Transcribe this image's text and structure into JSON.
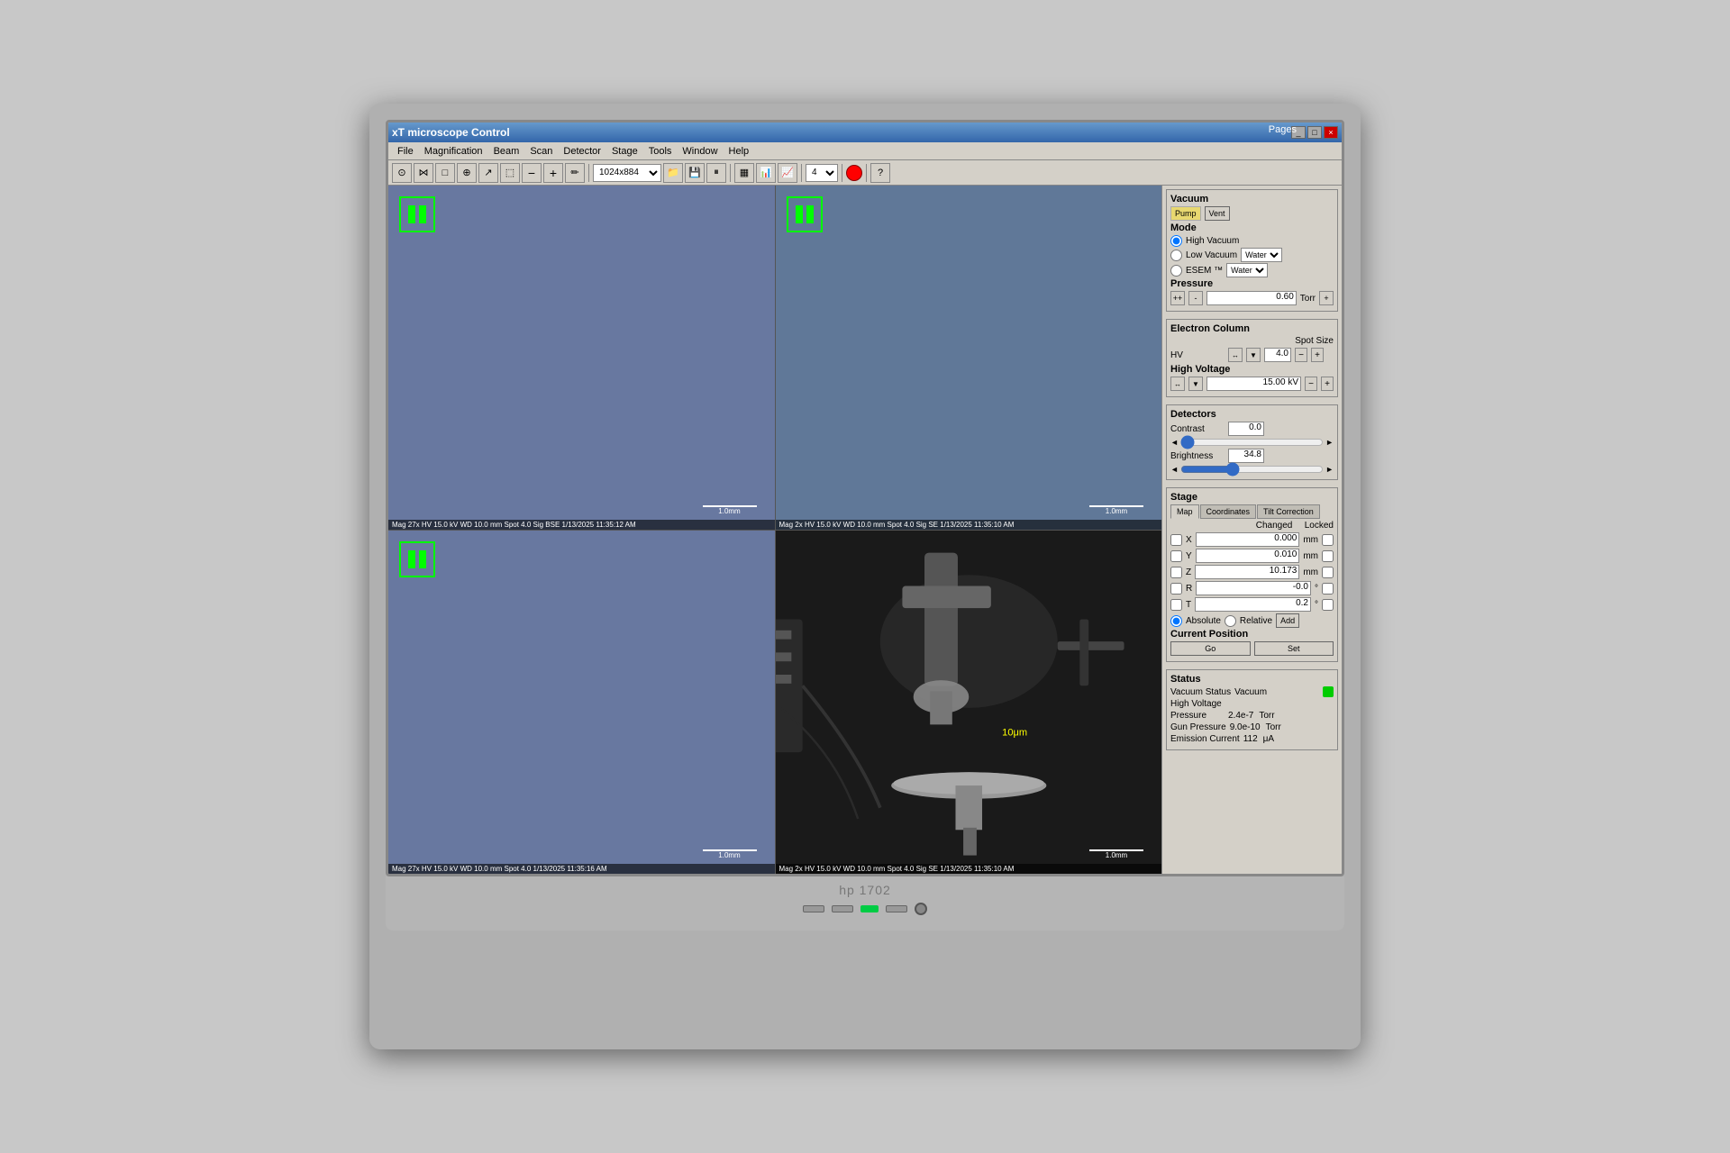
{
  "app": {
    "title": "xT microscope Control",
    "titlebar_controls": [
      "_",
      "□",
      "×"
    ]
  },
  "menu": {
    "items": [
      "File",
      "Magnification",
      "Beam",
      "Scan",
      "Detector",
      "Stage",
      "Tools",
      "Window",
      "Help"
    ]
  },
  "toolbar": {
    "resolution": "1024x884",
    "dropdown_num": "4"
  },
  "pages_label": "Pages",
  "panels": [
    {
      "id": "top-left",
      "info": "Mag 27x  HV 15.0 kV  WD 10.0 mm  Spot 4.0  Sig BSE  1/13/2025 11:35:12 AM",
      "scale": "1.0mm",
      "type": "blank"
    },
    {
      "id": "top-right",
      "info": "Mag 2x  HV 15.0 kV  WD 10.0 mm  Spot 4.0  Sig SE  1/13/2025 11:35:10 AM",
      "scale": "1.0mm",
      "type": "blank"
    },
    {
      "id": "bottom-left",
      "info": "Mag 27x  HV 15.0 kV  WD 10.0 mm  Spot 4.0  1/13/2025 11:35:16 AM",
      "scale": "1.0mm",
      "type": "blank"
    },
    {
      "id": "bottom-right",
      "info": "Mag 2x  HV 15.0 kV  WD 10.0 mm  Spot 4.0  Sig SE  1/13/2025 11:35:10 AM",
      "scale": "1.0mm",
      "type": "em"
    }
  ],
  "right_panel": {
    "vacuum": {
      "title": "Vacuum",
      "pump_label": "Pump",
      "vent_label": "Vent",
      "mode_title": "Mode",
      "high_vacuum": "High Vacuum",
      "low_vacuum": "Low Vacuum",
      "esem": "ESEM ™",
      "low_vacuum_medium": "Water",
      "esem_medium": "Water",
      "pressure_title": "Pressure",
      "pressure_value": "0.60",
      "pressure_unit": "Torr"
    },
    "electron_column": {
      "title": "Electron Column",
      "spot_size_label": "Spot Size",
      "hv_label": "HV",
      "spot_size_value": "4.0",
      "high_voltage_title": "High Voltage",
      "high_voltage_value": "15.00 kV"
    },
    "detectors": {
      "title": "Detectors",
      "contrast_label": "Contrast",
      "contrast_value": "0.0",
      "brightness_label": "Brightness",
      "brightness_value": "34.8"
    },
    "stage": {
      "title": "Stage",
      "tabs": [
        "Map",
        "Coordinates",
        "Tilt Correction"
      ],
      "changed_label": "Changed",
      "locked_label": "Locked",
      "x_label": "X",
      "x_value": "0.000",
      "x_unit": "mm",
      "y_label": "Y",
      "y_value": "0.010",
      "y_unit": "mm",
      "z_label": "Z",
      "z_value": "10.173",
      "z_unit": "mm",
      "r_label": "R",
      "r_value": "-0.0",
      "r_unit": "°",
      "t_label": "T",
      "t_value": "0.2",
      "t_unit": "°",
      "absolute_label": "Absolute",
      "relative_label": "Relative",
      "add_label": "Add",
      "current_position_label": "Current Position",
      "go_label": "Go",
      "set_label": "Set"
    },
    "status": {
      "title": "Status",
      "vacuum_status_label": "Vacuum Status",
      "vacuum_status_value": "Vacuum",
      "high_voltage_label": "High Voltage",
      "pressure_label": "Pressure",
      "pressure_value": "2.4e-7",
      "pressure_unit": "Torr",
      "gun_pressure_label": "Gun Pressure",
      "gun_pressure_value": "9.0e-10",
      "gun_pressure_unit": "Torr",
      "emission_label": "Emission Current",
      "emission_value": "112",
      "emission_unit": "μA"
    }
  },
  "monitor": {
    "brand": "hp 1702"
  }
}
